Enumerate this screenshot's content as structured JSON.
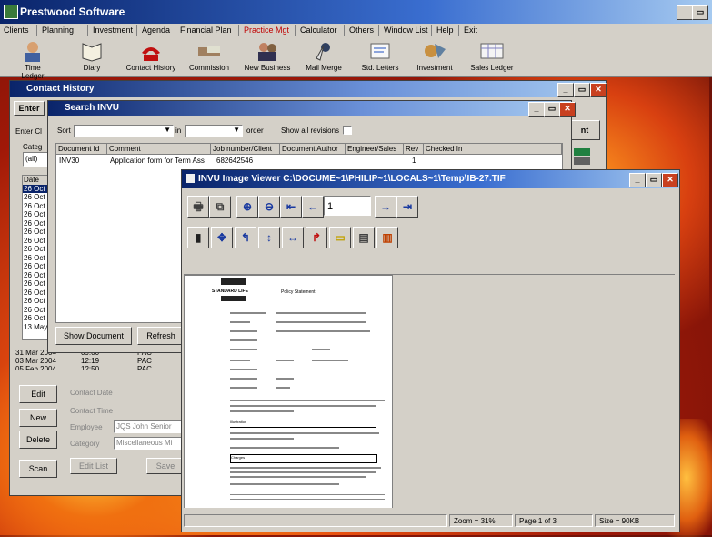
{
  "app": {
    "title": "Prestwood Software"
  },
  "menu": [
    "Clients",
    "Planning",
    "Investment",
    "Agenda",
    "Financial Plan",
    "Practice Mgt",
    "Calculator",
    "Others",
    "Window List",
    "Help",
    "Exit"
  ],
  "menu_active_color": "#c00000",
  "toolbar": [
    "Time Ledger",
    "Diary",
    "Contact History",
    "Commission",
    "New Business",
    "Mail Merge",
    "Std. Letters",
    "Investment",
    "Sales Ledger"
  ],
  "contact_history": {
    "title": "Contact History",
    "enter_tab": "Enter",
    "enter_cl_label": "Enter Cl",
    "category_label": "Categ",
    "category_value": "(all)",
    "date_header": "Date",
    "dates": [
      "26 Oct 2",
      "26 Oct 2",
      "26 Oct 2",
      "26 Oct 2",
      "26 Oct 2",
      "26 Oct 2",
      "26 Oct 2",
      "26 Oct 2",
      "26 Oct 2",
      "26 Oct 2",
      "26 Oct 2",
      "26 Oct 2",
      "26 Oct 2",
      "26 Oct 2",
      "26 Oct 2",
      "26 Oct 2",
      "13 May"
    ],
    "rows": [
      {
        "date": "31 Mar 2004",
        "time": "09:00",
        "by": "PAC"
      },
      {
        "date": "03 Mar 2004",
        "time": "12:19",
        "by": "PAC"
      },
      {
        "date": "05 Feb 2004",
        "time": "12:50",
        "by": "PAC"
      }
    ],
    "buttons": {
      "edit": "Edit",
      "new": "New",
      "delete": "Delete",
      "scan": "Scan",
      "edit_list": "Edit List",
      "save": "Save",
      "right_btn": "nt"
    },
    "form": {
      "contact_date": "Contact Date",
      "contact_time": "Contact Time",
      "employee_label": "Employee",
      "employee_value": "JQS John Senior",
      "category_label": "Category",
      "category_value": "Miscellaneous  Mi"
    }
  },
  "search": {
    "title": "Search INVU",
    "sort_label": "Sort",
    "in_label": "in",
    "order_label": "order",
    "show_revisions": "Show all revisions",
    "columns": [
      "Document Id",
      "Comment",
      "Job number/Client",
      "Document Author",
      "Engineer/Sales",
      "Rev",
      "Checked In"
    ],
    "rows": [
      {
        "id": "INV30",
        "comment": "Application form for Term Ass",
        "job": "682642546",
        "author": "",
        "engineer": "",
        "rev": "1",
        "checked": ""
      }
    ],
    "show_document": "Show Document",
    "refresh": "Refresh"
  },
  "viewer": {
    "title": "INVU Image Viewer  C:\\DOCUME~1\\PHILIP~1\\LOCALS~1\\Temp\\IB-27.TIF",
    "page_input": "1",
    "status": {
      "zoom": "Zoom = 31%",
      "page": "Page 1 of 3",
      "size": "Size = 90KB"
    },
    "doc": {
      "logo": "STANDARD LIFE",
      "heading": "Policy Statement",
      "section1": "Illustration",
      "section2": "Charges"
    }
  }
}
